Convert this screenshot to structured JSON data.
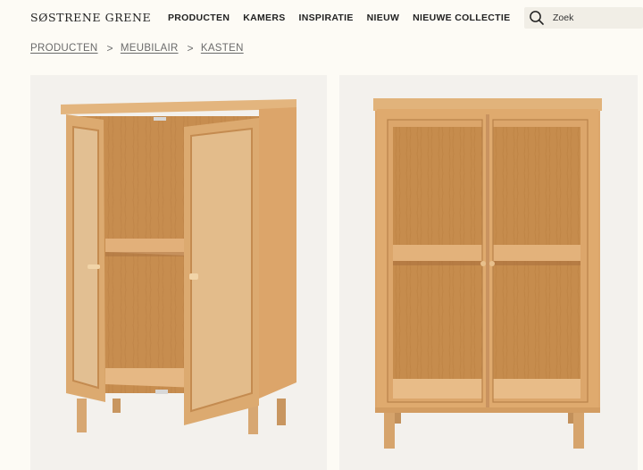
{
  "brand": {
    "logo_text": "SØSTRENE GRENE"
  },
  "nav": {
    "items": [
      {
        "label": "PRODUCTEN"
      },
      {
        "label": "KAMERS"
      },
      {
        "label": "INSPIRATIE"
      },
      {
        "label": "NIEUW"
      },
      {
        "label": "NIEUWE COLLECTIE"
      }
    ]
  },
  "search": {
    "placeholder": "Zoek",
    "icon": "search-icon"
  },
  "breadcrumb": {
    "items": [
      {
        "label": "PRODUCTEN"
      },
      {
        "label": "MEUBILAIR"
      },
      {
        "label": "KASTEN"
      }
    ],
    "separator": ">"
  },
  "gallery": {
    "images": [
      {
        "alt": "Houten vitrinekast met open glazen deuren"
      },
      {
        "alt": "Houten vitrinekast met gesloten glazen deuren"
      }
    ]
  },
  "colors": {
    "page_bg": "#fdfbf5",
    "card_bg": "#f3f1ed",
    "oak": "#d9a86e",
    "oak_dark": "#b98750"
  }
}
